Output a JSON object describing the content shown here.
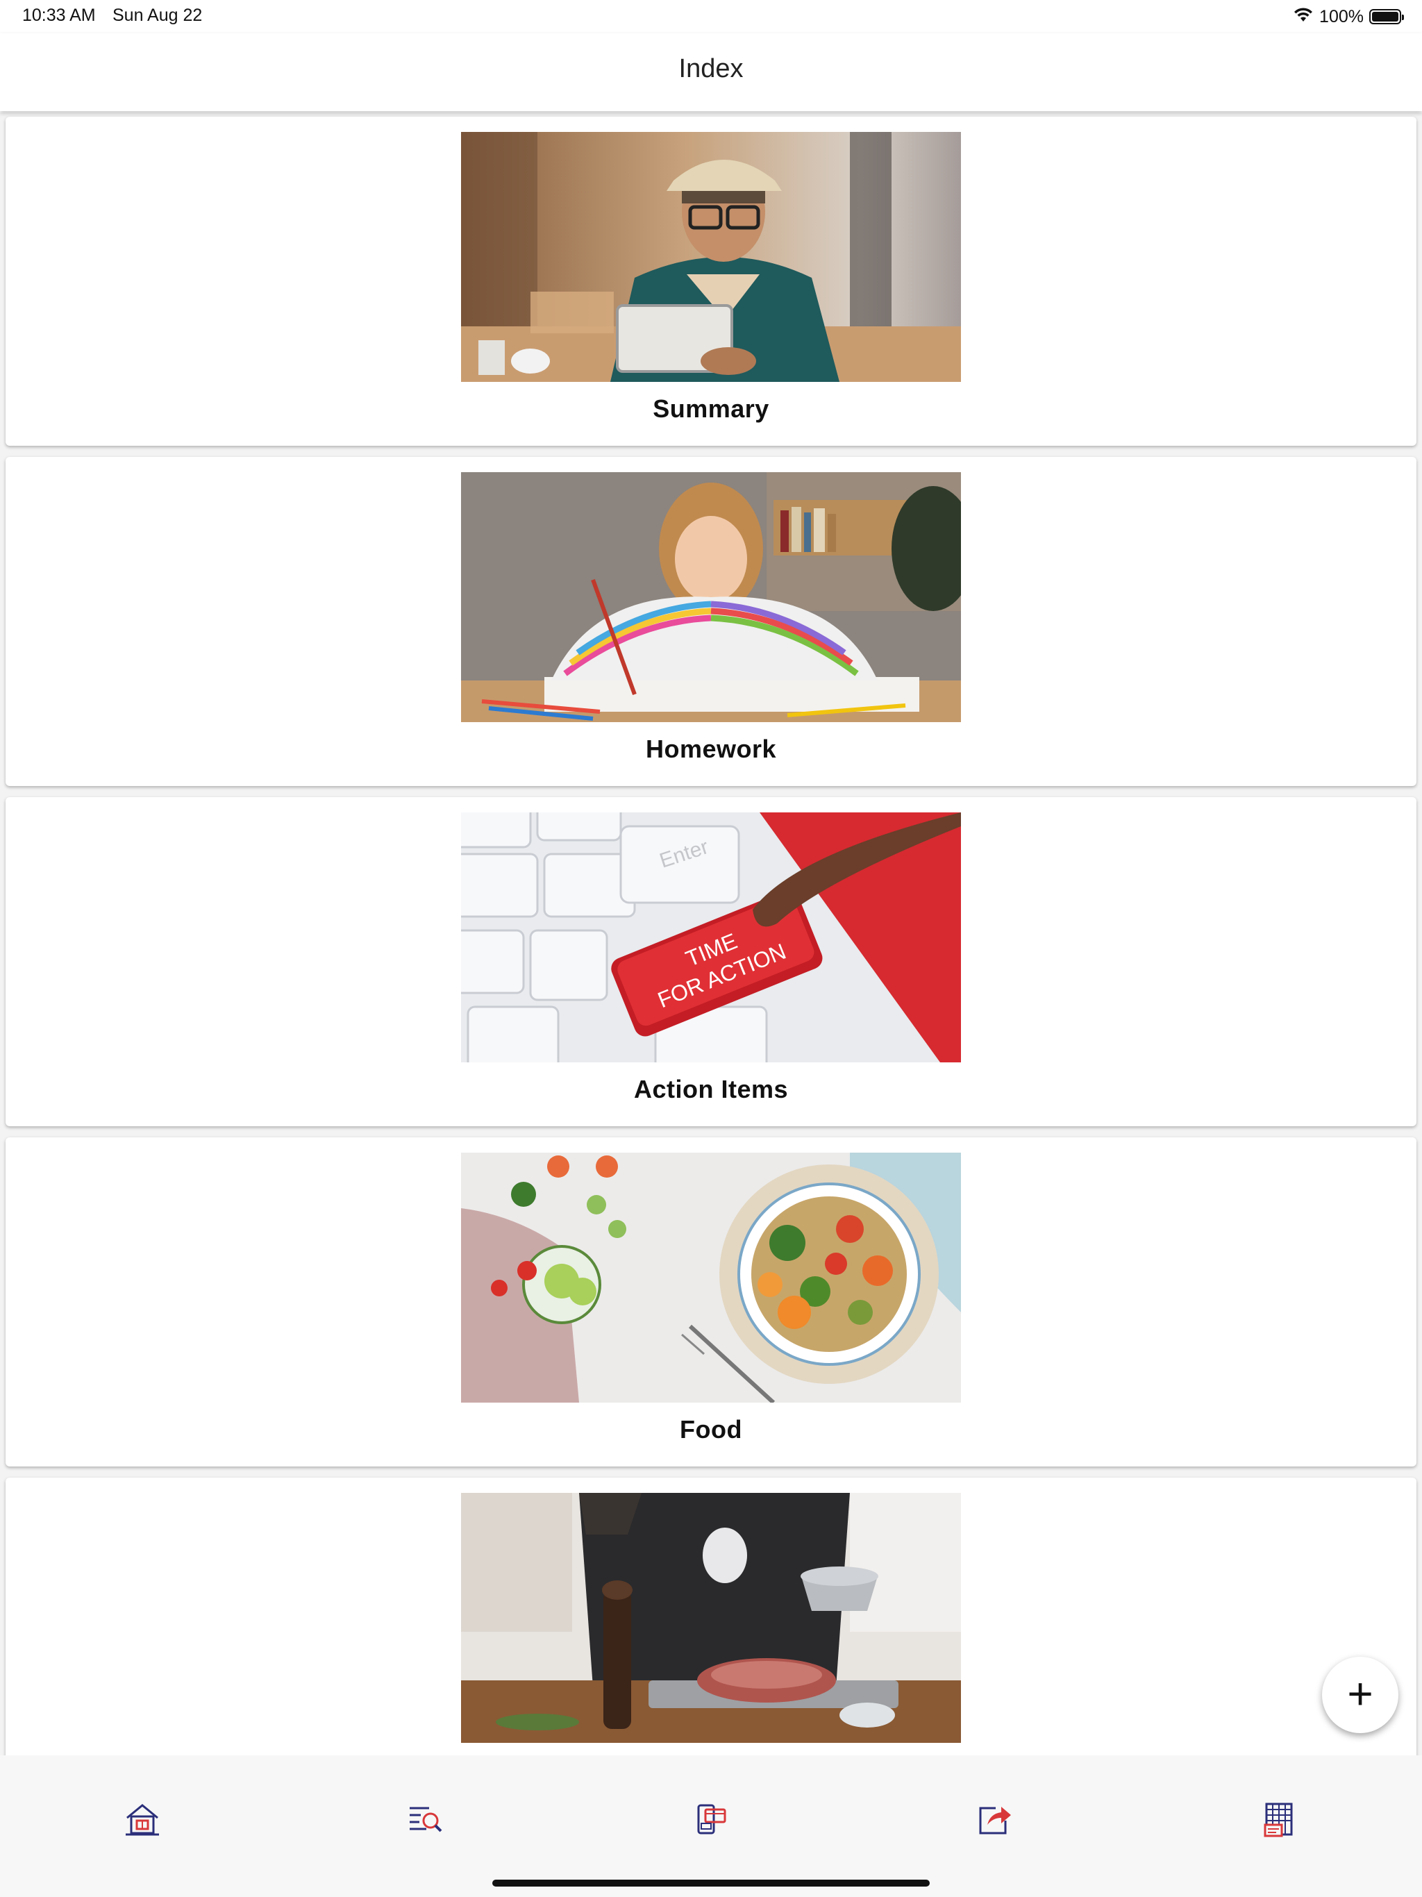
{
  "status": {
    "time": "10:33 AM",
    "date": "Sun Aug 22",
    "battery": "100%",
    "battery_level": 1.0,
    "wifi_icon": "wifi-icon"
  },
  "nav": {
    "title": "Index"
  },
  "cards": [
    {
      "label": "Summary",
      "image": "man-with-tablet-photo"
    },
    {
      "label": "Homework",
      "image": "girl-drawing-photo"
    },
    {
      "label": "Action Items",
      "image": "time-for-action-keyboard-photo",
      "key_text_1": "TIME",
      "key_text_2": "FOR ACTION",
      "enter_key": "Enter"
    },
    {
      "label": "Food",
      "image": "vegetable-bowl-photo"
    },
    {
      "label": "",
      "image": "chef-seasoning-meat-photo"
    }
  ],
  "fab": {
    "icon": "plus-icon"
  },
  "tabs": [
    {
      "icon": "home-icon"
    },
    {
      "icon": "search-list-icon"
    },
    {
      "icon": "payment-icon"
    },
    {
      "icon": "share-icon"
    },
    {
      "icon": "spreadsheet-icon"
    }
  ],
  "colors": {
    "icon_navy": "#2b2f7a",
    "icon_red": "#d8383a",
    "tab_bar_bg": "#f7f7f7"
  }
}
